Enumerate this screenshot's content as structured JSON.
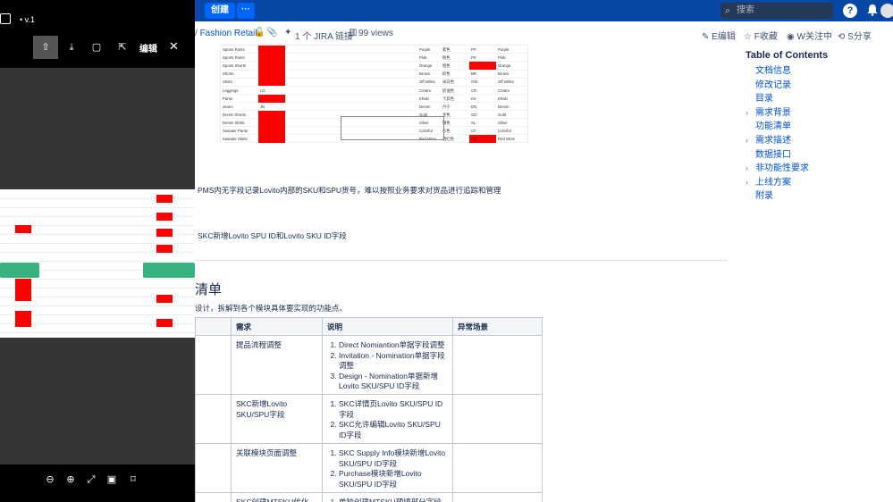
{
  "topnav": {
    "create_label": "创建",
    "more_label": "···",
    "search_placeholder": "搜索",
    "help_icon": "?"
  },
  "meta": {
    "breadcrumb": "Fashion Retail",
    "jira_label": "1 个 JIRA 链接",
    "views_label": "99 views",
    "edit_label": "E编辑",
    "favorite_label": "F收藏",
    "watch_label": "W关注中",
    "share_label": "S分享"
  },
  "toc": {
    "title": "Table of Contents",
    "items": [
      {
        "label": "文档信息",
        "expandable": false
      },
      {
        "label": "修改记录",
        "expandable": false
      },
      {
        "label": "目录",
        "expandable": false
      },
      {
        "label": "需求背景",
        "expandable": true
      },
      {
        "label": "功能清单",
        "expandable": false
      },
      {
        "label": "需求描述",
        "expandable": true
      },
      {
        "label": "数据接口",
        "expandable": false
      },
      {
        "label": "非功能性要求",
        "expandable": true
      },
      {
        "label": "上线方案",
        "expandable": true
      },
      {
        "label": "附录",
        "expandable": false
      }
    ]
  },
  "embedded_table": {
    "rows": [
      [
        "Sports Pants",
        "",
        "Purple",
        "紫色",
        "PP",
        "Purple"
      ],
      [
        "Sports Pants",
        "",
        "Pink",
        "粉色",
        "PK",
        "Pink"
      ],
      [
        "Sports Shorts",
        "",
        "Orange",
        "橙色",
        "",
        "Orange"
      ],
      [
        "Shorts",
        "",
        "Brown",
        "棕色",
        "BR",
        "Brown"
      ],
      [
        "Skirts",
        "",
        "Off White",
        "米白色",
        "OW",
        "Off White"
      ],
      [
        "Leggings",
        "LG",
        "Cream",
        "奶油色",
        "CR",
        "Cream"
      ],
      [
        "Pants",
        "",
        "Khaki",
        "卡其色",
        "KK",
        "Khaki"
      ],
      [
        "Jeans",
        "JN",
        "Denim",
        "丹宁",
        "DN",
        "Denim"
      ],
      [
        "Denim Shorts",
        "",
        "Gold",
        "金色",
        "GD",
        "Gold"
      ],
      [
        "Denim Skirts",
        "",
        "Silver",
        "银色",
        "SL",
        "Silver"
      ],
      [
        "Sweater Pants",
        "",
        "Colorful",
        "彩色",
        "CF",
        "Colorful"
      ],
      [
        "Sweater Skirts",
        "",
        "Red Wine",
        "酒红色",
        "RW",
        "Red Wine"
      ]
    ]
  },
  "body": {
    "para1": "PMS内无字段记录Lovito内部的SKU和SPU货号，难以按照业务要求对货品进行追踪和管理",
    "para2": "SKC新增Lovito SPU ID和Lovito SKU ID字段",
    "heading": "清单",
    "para3": "设计，拆解到各个模块具体要实现的功能点。"
  },
  "feature_table": {
    "headers": [
      "需求",
      "说明",
      "异常场景"
    ],
    "rows": [
      {
        "name": "提品流程调整",
        "items": [
          "Direct Nomiantion单据字段调整",
          "Invitation - Nomination单据字段调整",
          "Design - Nomination单据新增Lovito SKU/SPU ID字段"
        ]
      },
      {
        "name": "SKC新增Lovito SKU/SPU字段",
        "items": [
          "SKC详情页Lovito SKU/SPU ID字段",
          "SKC允许编辑Lovito SKU/SPU ID字段"
        ]
      },
      {
        "name": "关联模块页面调整",
        "items": [
          "SKC Supply Info模块新增Lovito SKU/SPU ID字段",
          "Purchase模块新增Lovito SKU/SPU ID字段"
        ]
      },
      {
        "name": "SKC创建MTSKU优化",
        "items": [
          "单独创建MTSKU预填部分字段"
        ]
      }
    ]
  },
  "overlay": {
    "version_label": "v.1",
    "edit_label": "编辑"
  }
}
